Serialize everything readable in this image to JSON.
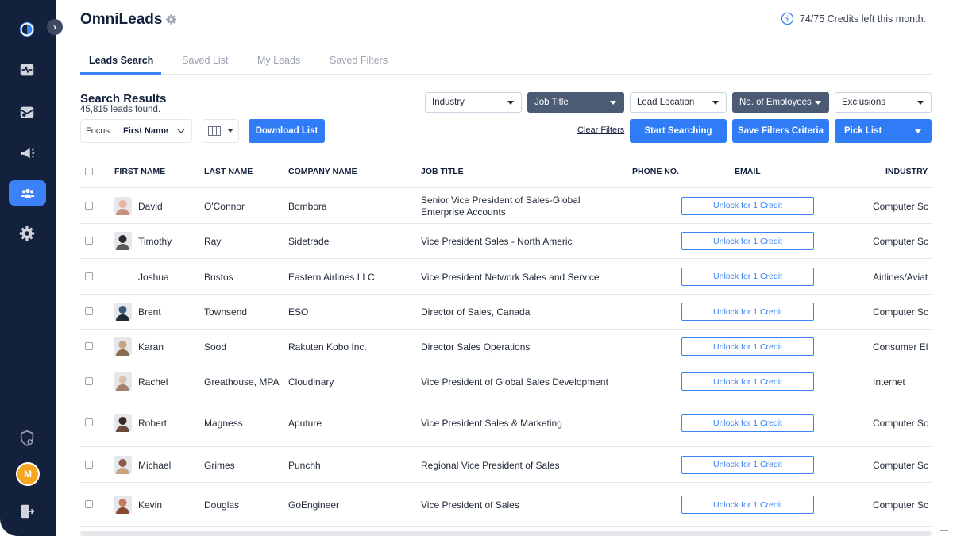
{
  "app": {
    "title": "OmniLeads"
  },
  "credits": {
    "text": "74/75 Credits left this month."
  },
  "tabs": [
    {
      "label": "Leads Search",
      "active": true
    },
    {
      "label": "Saved List",
      "active": false
    },
    {
      "label": "My Leads",
      "active": false
    },
    {
      "label": "Saved Filters",
      "active": false
    }
  ],
  "results": {
    "title": "Search Results",
    "count": "45,815 leads found."
  },
  "focus": {
    "label": "Focus:",
    "value": "First Name"
  },
  "buttons": {
    "download": "Download List",
    "clear_filters": "Clear Filters",
    "start_searching": "Start Searching",
    "save_filters": "Save Filters Criteria",
    "pick_list": "Pick List"
  },
  "filters": {
    "industry": "Industry",
    "job_title": "Job Title",
    "lead_location": "Lead Location",
    "employees": "No. of Employees",
    "exclusions": "Exclusions"
  },
  "table": {
    "headers": {
      "first_name": "FIRST NAME",
      "last_name": "LAST NAME",
      "company": "COMPANY NAME",
      "job_title": "JOB TITLE",
      "phone": "PHONE NO.",
      "email": "EMAIL",
      "industry": "INDUSTRY"
    },
    "unlock_label": "Unlock for 1 Credit",
    "rows": [
      {
        "first": "David",
        "last": "O'Connor",
        "company": "Bombora",
        "title": "Senior Vice President of Sales-Global Enterprise Accounts",
        "industry": "Computer Sc"
      },
      {
        "first": "Timothy",
        "last": "Ray",
        "company": "Sidetrade",
        "title": "Vice President Sales - North Americ",
        "industry": "Computer Sc"
      },
      {
        "first": "Joshua",
        "last": "Bustos",
        "company": "Eastern Airlines LLC",
        "title": "Vice President Network Sales and Service",
        "industry": "Airlines/Aviat"
      },
      {
        "first": "Brent",
        "last": "Townsend",
        "company": "ESO",
        "title": "Director of Sales, Canada",
        "industry": "Computer Sc"
      },
      {
        "first": "Karan",
        "last": "Sood",
        "company": "Rakuten Kobo Inc.",
        "title": "Director Sales Operations",
        "industry": "Consumer El"
      },
      {
        "first": "Rachel",
        "last": "Greathouse, MPA",
        "company": "Cloudinary",
        "title": "Vice President of Global Sales Development",
        "industry": "Internet"
      },
      {
        "first": "Robert",
        "last": "Magness",
        "company": "Aputure",
        "title": "Vice President Sales & Marketing",
        "industry": "Computer Sc"
      },
      {
        "first": "Michael",
        "last": "Grimes",
        "company": "Punchh",
        "title": "Regional Vice President of Sales",
        "industry": "Computer Sc"
      },
      {
        "first": "Kevin",
        "last": "Douglas",
        "company": "GoEngineer",
        "title": "Vice President of Sales",
        "industry": "Computer Sc"
      }
    ]
  },
  "sidebar": {
    "avatar_initial": "M"
  },
  "colors": {
    "sidebar": "#14213d",
    "accent": "#2f7cf6",
    "dark_filter": "#4b5b74"
  }
}
